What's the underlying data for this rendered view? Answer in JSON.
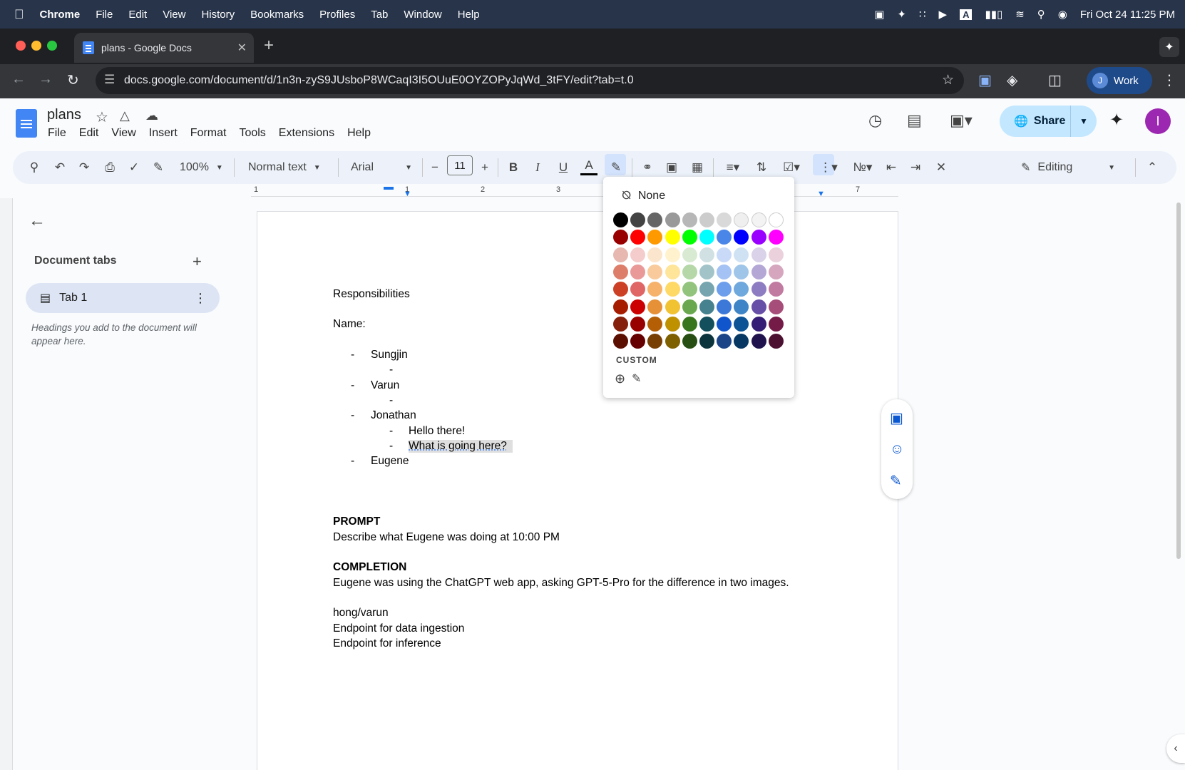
{
  "macos": {
    "app": "Chrome",
    "menus": [
      "File",
      "Edit",
      "View",
      "History",
      "Bookmarks",
      "Profiles",
      "Tab",
      "Window",
      "Help"
    ],
    "datetime": "Fri Oct 24  11:25 PM"
  },
  "browser": {
    "tab_title": "plans - Google Docs",
    "url": "docs.google.com/document/d/1n3n-zyS9JUsboP8WCaqI3I5OUuE0OYZOPyJqWd_3tFY/edit?tab=t.0",
    "profile_initial": "J",
    "profile_label": "Work"
  },
  "docs": {
    "title": "plans",
    "menus": [
      "File",
      "Edit",
      "View",
      "Insert",
      "Format",
      "Tools",
      "Extensions",
      "Help"
    ],
    "share_label": "Share",
    "avatar_initial": "I",
    "toolbar": {
      "zoom": "100%",
      "style": "Normal text",
      "font": "Arial",
      "font_size": "11",
      "mode": "Editing"
    },
    "ruler_numbers": [
      "1",
      "1",
      "2",
      "3",
      "7"
    ],
    "sidebar": {
      "title": "Document tabs",
      "tab_label": "Tab 1",
      "hint": "Headings you add to the document will appear here."
    },
    "content": {
      "heading": "Responsibilities",
      "name_label": "Name:",
      "bullets": {
        "sungjin": "Sungjin",
        "varun": "Varun",
        "jonathan": "Jonathan",
        "hello": "Hello there!",
        "what": "What is going here?",
        "eugene": "Eugene",
        "dash": "-"
      },
      "prompt_title": "PROMPT",
      "prompt_text": "Describe what Eugene was doing at 10:00 PM",
      "completion_title": "COMPLETION",
      "completion_text": "Eugene was using the ChatGPT web app, asking GPT-5-Pro for the difference in two images.",
      "owner": "hong/varun",
      "endpoint1": "Endpoint for data ingestion",
      "endpoint2": "Endpoint for inference"
    },
    "highlight_popup": {
      "none_label": "None",
      "custom_label": "CUSTOM",
      "palette": [
        [
          "#000000",
          "#434343",
          "#666666",
          "#999999",
          "#b7b7b7",
          "#cccccc",
          "#d9d9d9",
          "#efefef",
          "#f3f3f3",
          "#ffffff"
        ],
        [
          "#980000",
          "#ff0000",
          "#ff9900",
          "#ffff00",
          "#00ff00",
          "#00ffff",
          "#4a86e8",
          "#0000ff",
          "#9900ff",
          "#ff00ff"
        ],
        [
          "#e6b8af",
          "#f4cccc",
          "#fce5cd",
          "#fff2cc",
          "#d9ead3",
          "#d0e0e3",
          "#c9daf8",
          "#cfe2f3",
          "#d9d2e9",
          "#ead1dc"
        ],
        [
          "#dd7e6b",
          "#ea9999",
          "#f9cb9c",
          "#ffe599",
          "#b6d7a8",
          "#a2c4c9",
          "#a4c2f4",
          "#9fc5e8",
          "#b4a7d6",
          "#d5a6bd"
        ],
        [
          "#cc4125",
          "#e06666",
          "#f6b26b",
          "#ffd966",
          "#93c47d",
          "#76a5af",
          "#6d9eeb",
          "#6fa8dc",
          "#8e7cc3",
          "#c27ba0"
        ],
        [
          "#a61c00",
          "#cc0000",
          "#e69138",
          "#f1c232",
          "#6aa84f",
          "#45818e",
          "#3c78d8",
          "#3d85c6",
          "#674ea7",
          "#a64d79"
        ],
        [
          "#85200c",
          "#990000",
          "#b45f06",
          "#bf9000",
          "#38761d",
          "#134f5c",
          "#1155cc",
          "#0b5394",
          "#351c75",
          "#741b47"
        ],
        [
          "#5b0f00",
          "#660000",
          "#783f04",
          "#7f6000",
          "#274e13",
          "#0c343d",
          "#1c4587",
          "#073763",
          "#20124d",
          "#4c1130"
        ]
      ]
    }
  }
}
